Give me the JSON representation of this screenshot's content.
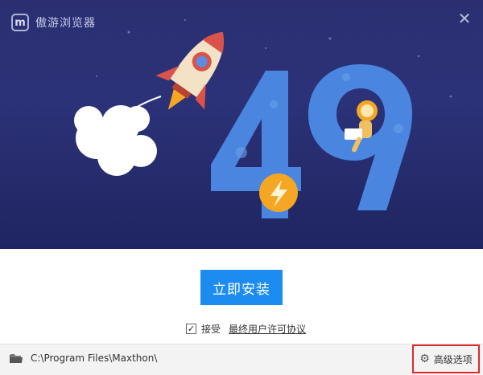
{
  "window": {
    "title": "傲游浏览器",
    "logo_letter": "m",
    "close_glyph": "✕"
  },
  "hero": {
    "version_major": "4",
    "version_dot": ".",
    "version_minor": "9",
    "colors": {
      "background": "#2b2f72",
      "digits": "#4a86e0",
      "badge": "#f5a623",
      "rocket_body": "#f3e2c6",
      "rocket_red": "#d9534a"
    },
    "icons": [
      "rocket-icon",
      "lightning-icon",
      "astronaut-icon"
    ]
  },
  "install": {
    "button_label": "立即安装",
    "color": "#1d8cf0"
  },
  "agreement": {
    "checked": true,
    "check_glyph": "✓",
    "accept_label": "接受",
    "license_link": "最终用户许可协议"
  },
  "footer": {
    "path": "C:\\Program Files\\Maxthon\\",
    "advanced_label": "高级选项",
    "gear_glyph": "⚙",
    "highlight_color": "#e0282d"
  }
}
